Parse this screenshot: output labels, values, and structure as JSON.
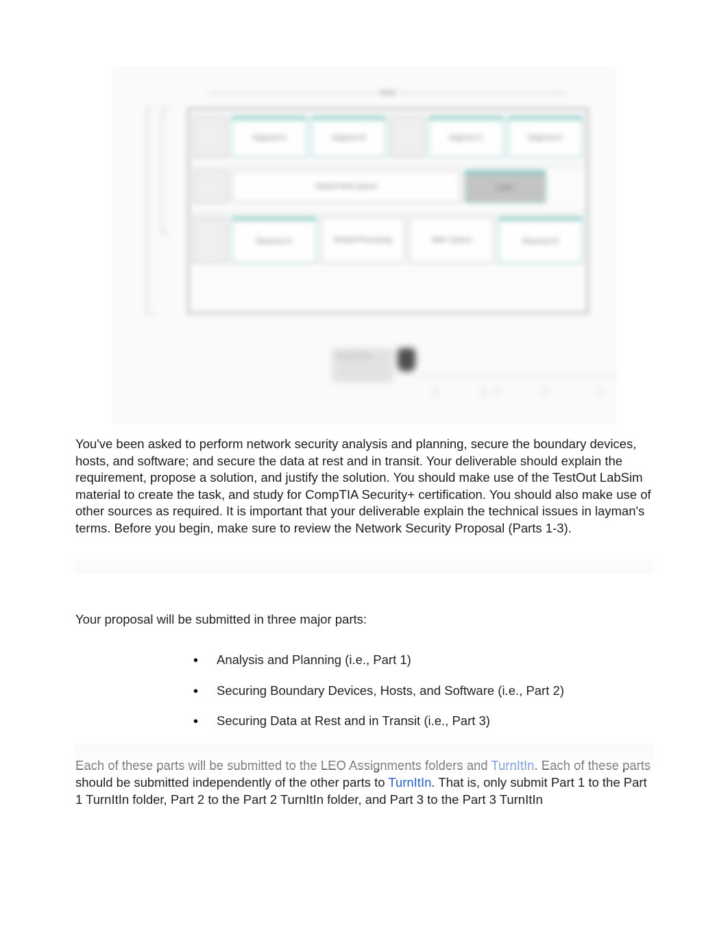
{
  "diagram": {
    "topAxis": "time",
    "row1": [
      "",
      "Segment A",
      "Segment B",
      "",
      "Segment C",
      "Segment D"
    ],
    "row2Center": "Shared Work Queue",
    "row2Right": "buffer",
    "row3": [
      "",
      "Resource A",
      "Shared Processing",
      "Wait / Queue",
      "Resource B"
    ],
    "caption": "Process flow"
  },
  "body": {
    "intro": "You've been asked to perform network security analysis and planning, secure the boundary devices, hosts, and software; and secure the data at rest and in transit. Your deliverable should explain the requirement, propose a solution, and justify the solution. You should make use of the TestOut LabSim material to create the task, and study for CompTIA Security+ certification. You should also make use of other sources as required. It is important that your deliverable explain the technical issues in layman's terms. Before you begin, make sure to review the Network Security Proposal (Parts 1-3).",
    "lead": "Your proposal will be submitted in three major parts:",
    "bullets": [
      "Analysis and Planning (i.e., Part 1)",
      "Securing Boundary Devices, Hosts, and Software (i.e., Part 2)",
      "Securing Data at Rest and in Transit (i.e., Part 3)"
    ],
    "sub_pre": "Each of these parts will be submitted to the LEO Assignments folders and ",
    "link1": "TurnItIn",
    "sub_mid": ". Each of these parts should be submitted independently of the other parts to ",
    "link2": "TurnItIn",
    "sub_post": ". That is, only submit Part 1 to the Part 1 TurnItIn folder, Part 2 to the Part 2 TurnItIn folder, and Part 3 to the Part 3 TurnItIn"
  }
}
